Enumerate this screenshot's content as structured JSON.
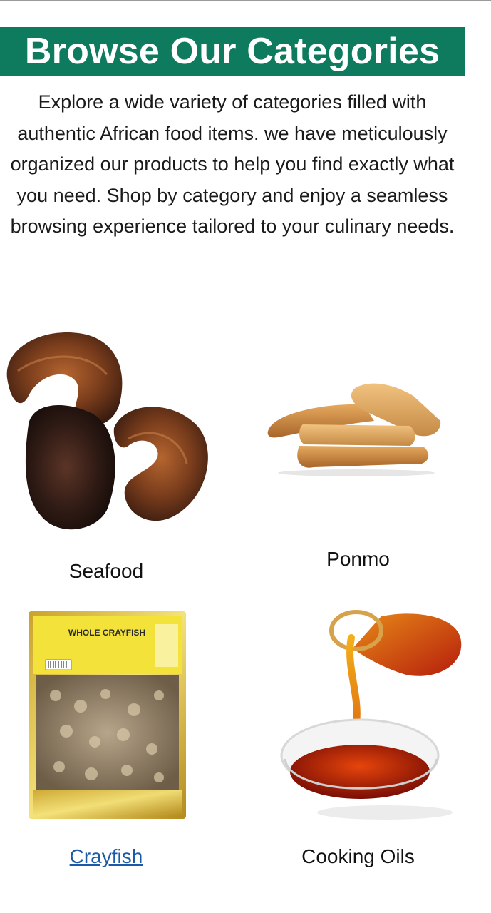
{
  "header": {
    "title": "Browse Our Categories"
  },
  "intro": {
    "text": "Explore a wide variety of categories filled with authentic African food items. we have meticulously organized our products to help you find exactly what you need. Shop by category and enjoy a seamless browsing experience tailored to your culinary needs."
  },
  "categories": [
    {
      "label": "Seafood"
    },
    {
      "label": "Ponmo"
    },
    {
      "label": "Crayfish",
      "package_text": "WHOLE CRAYFISH"
    },
    {
      "label": "Cooking Oils"
    }
  ],
  "colors": {
    "banner_bg": "#0e7a5e",
    "link": "#1a5aa6"
  }
}
